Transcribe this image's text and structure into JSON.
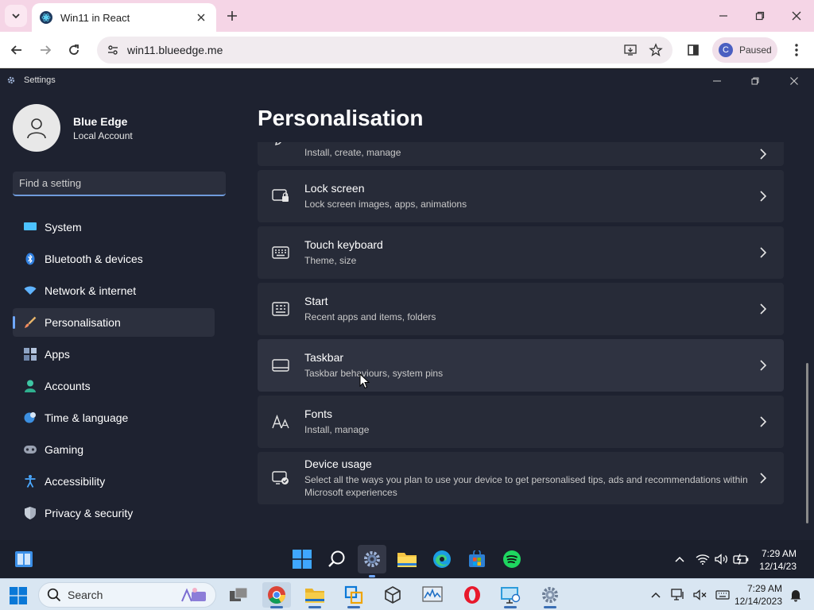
{
  "browser": {
    "tab_title": "Win11 in React",
    "url": "win11.blueedge.me",
    "profile_initial": "C",
    "profile_label": "Paused"
  },
  "app": {
    "title": "Settings",
    "user": {
      "name": "Blue Edge",
      "account": "Local Account"
    },
    "search_placeholder": "Find a setting",
    "nav": [
      {
        "label": "System",
        "icon": "monitor-icon"
      },
      {
        "label": "Bluetooth & devices",
        "icon": "bluetooth-icon"
      },
      {
        "label": "Network & internet",
        "icon": "wifi-icon"
      },
      {
        "label": "Personalisation",
        "icon": "brush-icon",
        "active": true
      },
      {
        "label": "Apps",
        "icon": "apps-icon"
      },
      {
        "label": "Accounts",
        "icon": "person-icon"
      },
      {
        "label": "Time & language",
        "icon": "globe-clock-icon"
      },
      {
        "label": "Gaming",
        "icon": "gamepad-icon"
      },
      {
        "label": "Accessibility",
        "icon": "accessibility-icon"
      },
      {
        "label": "Privacy & security",
        "icon": "shield-icon"
      }
    ],
    "page_title": "Personalisation",
    "cards": [
      {
        "title": "",
        "subtitle": "Install, create, manage",
        "icon": "pen-icon"
      },
      {
        "title": "Lock screen",
        "subtitle": "Lock screen images, apps, animations",
        "icon": "lock-screen-icon"
      },
      {
        "title": "Touch keyboard",
        "subtitle": "Theme, size",
        "icon": "keyboard-icon"
      },
      {
        "title": "Start",
        "subtitle": "Recent apps and items, folders",
        "icon": "start-icon"
      },
      {
        "title": "Taskbar",
        "subtitle": "Taskbar behaviours, system pins",
        "icon": "taskbar-icon"
      },
      {
        "title": "Fonts",
        "subtitle": "Install, manage",
        "icon": "fonts-icon"
      },
      {
        "title": "Device usage",
        "subtitle": "Select all the ways you plan to use your device to get personalised tips, ads and recommendations within Microsoft experiences",
        "icon": "device-usage-icon"
      }
    ]
  },
  "taskbar_inner": {
    "time": "7:29 AM",
    "date": "12/14/23"
  },
  "taskbar_host": {
    "search_label": "Search",
    "time": "7:29 AM",
    "date": "12/14/2023"
  },
  "colors": {
    "accent": "#6fa8ff",
    "app_bg": "#1e2230",
    "card_bg": "#272b38",
    "chrome_tab_strip": "#f5d5e6"
  }
}
